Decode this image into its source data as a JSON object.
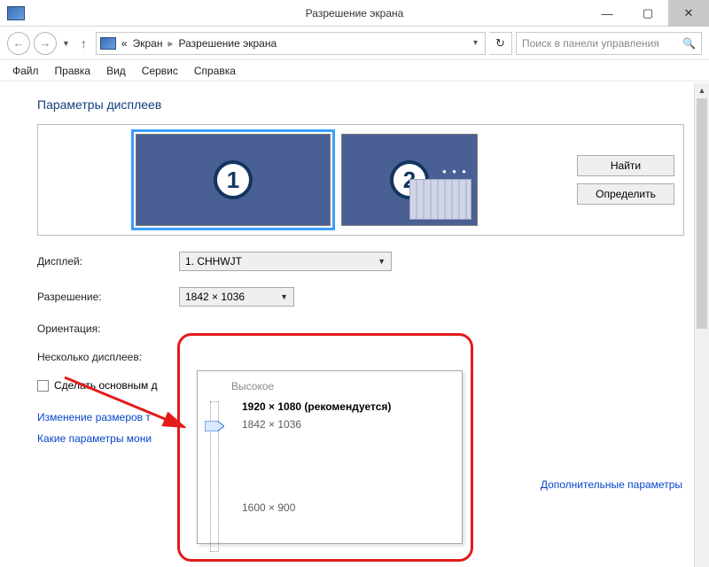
{
  "window": {
    "title": "Разрешение экрана"
  },
  "nav": {
    "back": "←",
    "forward": "→",
    "history_drop": "▼",
    "up": "↑",
    "chevrons": "«",
    "crumb1": "Экран",
    "crumb2": "Разрешение экрана",
    "refresh": "↻",
    "search_placeholder": "Поиск в панели управления"
  },
  "menu": {
    "file": "Файл",
    "edit": "Правка",
    "view": "Вид",
    "service": "Сервис",
    "help": "Справка"
  },
  "heading": "Параметры дисплеев",
  "monitors": {
    "n1": "1",
    "n2": "2"
  },
  "buttons": {
    "find": "Найти",
    "identify": "Определить"
  },
  "labels": {
    "display": "Дисплей:",
    "resolution": "Разрешение:",
    "orientation": "Ориентация:",
    "multi": "Несколько дисплеев:",
    "make_primary": "Сделать основным д",
    "advanced": "Дополнительные параметры",
    "resize": "Изменение размеров т",
    "which": "Какие параметры мони"
  },
  "values": {
    "display_selected": "1. CHHWJT",
    "resolution_selected": "1842 × 1036"
  },
  "popup": {
    "category": "Высокое",
    "opt_rec": "1920 × 1080 (рекомендуется)",
    "opt_current": "1842 × 1036",
    "opt_low": "1600 × 900"
  }
}
